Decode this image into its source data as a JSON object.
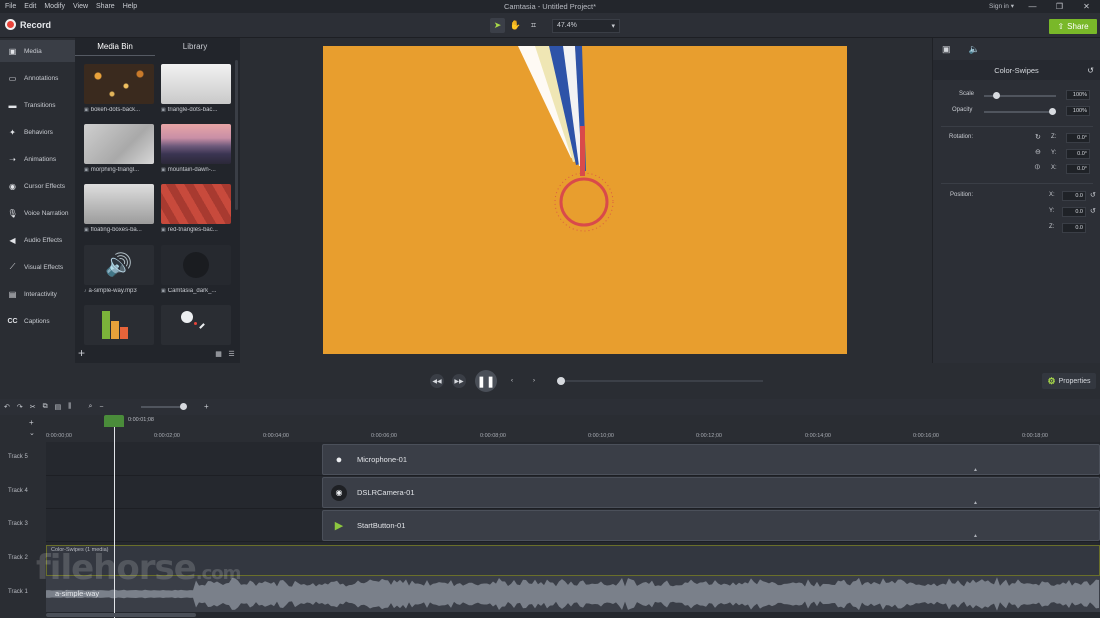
{
  "menu": {
    "items": [
      "File",
      "Edit",
      "Modify",
      "View",
      "Share",
      "Help"
    ]
  },
  "window": {
    "title": "Camtasia - Untitled Project*",
    "signin": "Sign in ▾"
  },
  "toolbar": {
    "record_label": "Record",
    "zoom_value": "47.4%",
    "share_label": "Share"
  },
  "sidebar": {
    "items": [
      {
        "label": "Media",
        "icon": "film-icon"
      },
      {
        "label": "Annotations",
        "icon": "annotation-icon"
      },
      {
        "label": "Transitions",
        "icon": "transition-icon"
      },
      {
        "label": "Behaviors",
        "icon": "behavior-icon"
      },
      {
        "label": "Animations",
        "icon": "animation-icon"
      },
      {
        "label": "Cursor Effects",
        "icon": "cursor-icon"
      },
      {
        "label": "Voice Narration",
        "icon": "microphone-icon"
      },
      {
        "label": "Audio Effects",
        "icon": "speaker-icon"
      },
      {
        "label": "Visual Effects",
        "icon": "wand-icon"
      },
      {
        "label": "Interactivity",
        "icon": "interactivity-icon"
      },
      {
        "label": "Captions",
        "icon": "captions-icon"
      }
    ]
  },
  "mediabin": {
    "tabs": [
      "Media Bin",
      "Library"
    ],
    "items": [
      {
        "label": "bokeh-dots-back..."
      },
      {
        "label": "triangle-dots-bac..."
      },
      {
        "label": "morphing-triangl..."
      },
      {
        "label": "mountain-dawn-..."
      },
      {
        "label": "floating-boxes-ba..."
      },
      {
        "label": "red-triangles-bac..."
      },
      {
        "label": "a-simple-way.mp3"
      },
      {
        "label": "Camtasia_dark_..."
      }
    ]
  },
  "properties": {
    "title": "Color-Swipes",
    "scale_label": "Scale",
    "scale_value": "100%",
    "scale_level": 1.0,
    "opacity_label": "Opacity",
    "opacity_value": "100%",
    "opacity_level": 1.0,
    "rotation_label": "Rotation:",
    "rotation": {
      "z": "0.0°",
      "y": "0.0°",
      "x": "0.0°"
    },
    "position_label": "Position:",
    "position": {
      "x": "0.0",
      "y": "0.0",
      "z": "0.0"
    },
    "axis_labels": {
      "z": "Z:",
      "y": "Y:",
      "x": "X:"
    },
    "button_label": "Properties"
  },
  "timeline": {
    "playhead_time": "0:00:01;08",
    "ticks": [
      "0:00:00;00",
      "0:00:02;00",
      "0:00:04;00",
      "0:00:06;00",
      "0:00:08;00",
      "0:00:10;00",
      "0:00:12;00",
      "0:00:14;00",
      "0:00:16;00",
      "0:00:18;00"
    ],
    "tracks": [
      "Track 5",
      "Track 4",
      "Track 3",
      "Track 2",
      "Track 1"
    ],
    "clips": [
      "Microphone-01",
      "DSLRCamera-01",
      "StartButton-01"
    ],
    "group_label": "Color-Swipes  (1 media)",
    "audio_label": "a-simple-way"
  },
  "watermark": {
    "text": "filehorse",
    "suffix": ".com"
  },
  "colors": {
    "accent": "#79b829",
    "record": "#e8443a",
    "canvas": "#e89e2e"
  }
}
